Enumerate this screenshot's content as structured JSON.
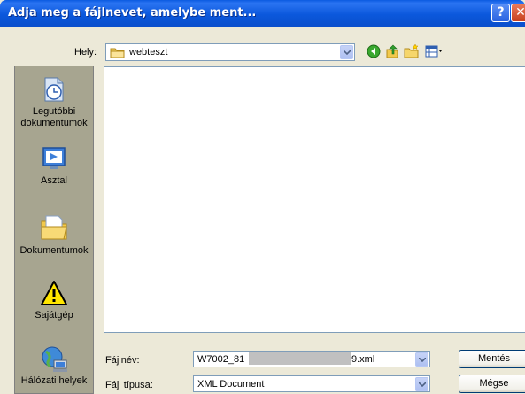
{
  "window": {
    "title": "Adja meg a fájlnevet, amelybe ment...",
    "help_glyph": "?",
    "close_glyph": "✕"
  },
  "location": {
    "label": "Hely:",
    "value": "webteszt",
    "icon": "folder-icon"
  },
  "toolbar": {
    "icons": [
      "back-icon",
      "up-folder-icon",
      "new-folder-icon",
      "view-menu-icon"
    ]
  },
  "places": [
    {
      "label": "Legutóbbi dokumentumok",
      "icon": "recent-documents-icon"
    },
    {
      "label": "Asztal",
      "icon": "desktop-icon"
    },
    {
      "label": "Dokumentumok",
      "icon": "my-documents-icon"
    },
    {
      "label": "Sajátgép",
      "icon": "warning-icon"
    },
    {
      "label": "Hálózati helyek",
      "icon": "network-places-icon"
    }
  ],
  "filename": {
    "label": "Fájlnév:",
    "value_start": "W7002_81",
    "value_end": "9.xml"
  },
  "filetype": {
    "label": "Fájl típusa:",
    "value": "XML Document"
  },
  "buttons": {
    "save": "Mentés",
    "cancel": "Mégse"
  },
  "colors": {
    "titlebar": "#0a58dc",
    "dialog_bg": "#ece9d8",
    "places_bg": "#a7a590"
  }
}
